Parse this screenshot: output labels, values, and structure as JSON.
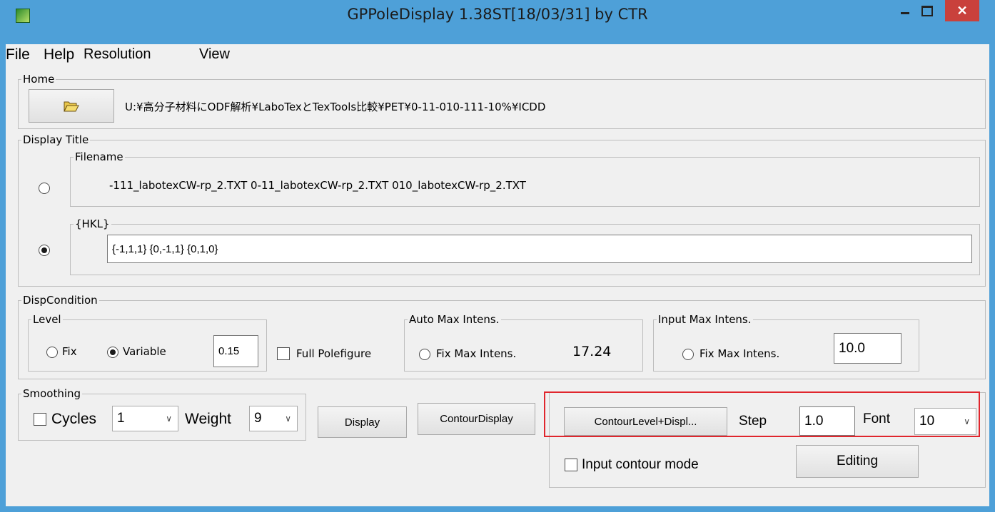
{
  "window": {
    "title": "GPPoleDisplay 1.38ST[18/03/31] by CTR"
  },
  "menu": {
    "file": "File",
    "help": "Help",
    "resolution": "Resolution",
    "view": "View"
  },
  "home": {
    "legend": "Home",
    "open_icon": "open-folder-icon",
    "path": "U:¥高分子材料にODF解析¥LaboTexとTexTools比較¥PET¥0-11-010-111-10%¥ICDD"
  },
  "display_title": {
    "legend": "Display Title",
    "filename_legend": "Filename",
    "filename_value": "-111_labotexCW-rp_2.TXT  0-11_labotexCW-rp_2.TXT  010_labotexCW-rp_2.TXT",
    "hkl_legend": "{HKL}",
    "hkl_value": "{-1,1,1} {0,-1,1} {0,1,0}"
  },
  "disp_condition": {
    "legend": "DispCondition",
    "level_legend": "Level",
    "fix": "Fix",
    "variable": "Variable",
    "level_value": "0.15",
    "full_polefigure": "Full Polefigure",
    "auto_legend": "Auto Max Intens.",
    "auto_fix": "Fix Max Intens.",
    "auto_value": "17.24",
    "input_legend": "Input Max Intens.",
    "input_fix": "Fix Max Intens.",
    "input_value": "10.0"
  },
  "smoothing": {
    "legend": "Smoothing",
    "cycles_label": "Cycles",
    "cycles_value": "1",
    "weight_label": "Weight",
    "weight_value": "9"
  },
  "buttons": {
    "display": "Display",
    "contour_display": "ContourDisplay",
    "contour_level_display": "ContourLevel+Displ...",
    "editing": "Editing"
  },
  "contour": {
    "step_label": "Step",
    "step_value": "1.0",
    "font_label": "Font",
    "font_value": "10",
    "input_contour_mode": "Input contour mode"
  },
  "colors": {
    "titlebar": "#4ea0d8",
    "close": "#c9413c",
    "highlight": "#e0262d"
  }
}
